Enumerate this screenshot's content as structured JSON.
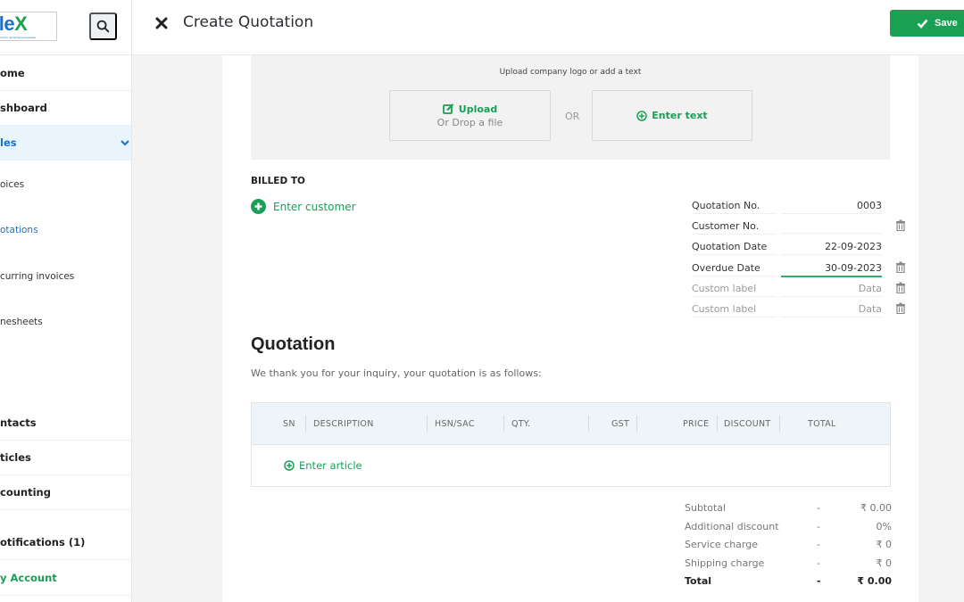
{
  "app": {
    "logo_text_main": "ofle",
    "logo_text_x": "X",
    "logo_tagline": "solutions for growing businesses"
  },
  "sidebar": {
    "items": [
      {
        "label": "ome",
        "active": false
      },
      {
        "label": "shboard",
        "active": false
      },
      {
        "label": "les",
        "active": true,
        "expanded": true
      },
      {
        "label": "oices",
        "sub": true
      },
      {
        "label": "otations",
        "sub": true,
        "active": true
      },
      {
        "label": "curring invoices",
        "sub": true
      },
      {
        "label": "nesheets",
        "sub": true
      },
      {
        "label": "ntacts"
      },
      {
        "label": "ticles"
      },
      {
        "label": "counting"
      },
      {
        "label": "otifications (1)"
      },
      {
        "label": "y Account",
        "green": true
      }
    ]
  },
  "header": {
    "title": "Create Quotation",
    "save_label": "Save"
  },
  "upload": {
    "caption": "Upload company logo or add a text",
    "upload_label": "Upload",
    "drop_hint": "Or Drop a file",
    "or_label": "OR",
    "enter_text_label": "Enter text"
  },
  "billing": {
    "billed_to_label": "BILLED TO",
    "enter_customer_label": "Enter customer"
  },
  "meta": [
    {
      "label": "Quotation No.",
      "value": "0003"
    },
    {
      "label": "Customer No.",
      "value": ""
    },
    {
      "label": "Quotation Date",
      "value": "22-09-2023"
    },
    {
      "label": "Overdue Date",
      "value": "30-09-2023"
    },
    {
      "label": "Custom label",
      "value": "Data"
    },
    {
      "label": "Custom label",
      "value": "Data"
    }
  ],
  "quotation": {
    "heading": "Quotation",
    "intro": "We thank you for your inquiry, your quotation is as follows:"
  },
  "table": {
    "columns": [
      "SN",
      "DESCRIPTION",
      "HSN/SAC",
      "QTY.",
      "GST",
      "PRICE",
      "DISCOUNT",
      "TOTAL"
    ],
    "enter_article_label": "Enter article"
  },
  "totals": [
    {
      "label": "Subtotal",
      "sep": "-",
      "value": "₹ 0.00"
    },
    {
      "label": "Additional discount",
      "sep": "-",
      "value": "0%"
    },
    {
      "label": "Service charge",
      "sep": "-",
      "value": "₹ 0"
    },
    {
      "label": "Shipping charge",
      "sep": "-",
      "value": "₹ 0"
    },
    {
      "label": "Total",
      "sep": "-",
      "value": "₹ 0.00"
    }
  ],
  "colors": {
    "accent_green": "#19a052",
    "link_blue": "#1a72c9",
    "active_bg": "#e9f4fd"
  }
}
